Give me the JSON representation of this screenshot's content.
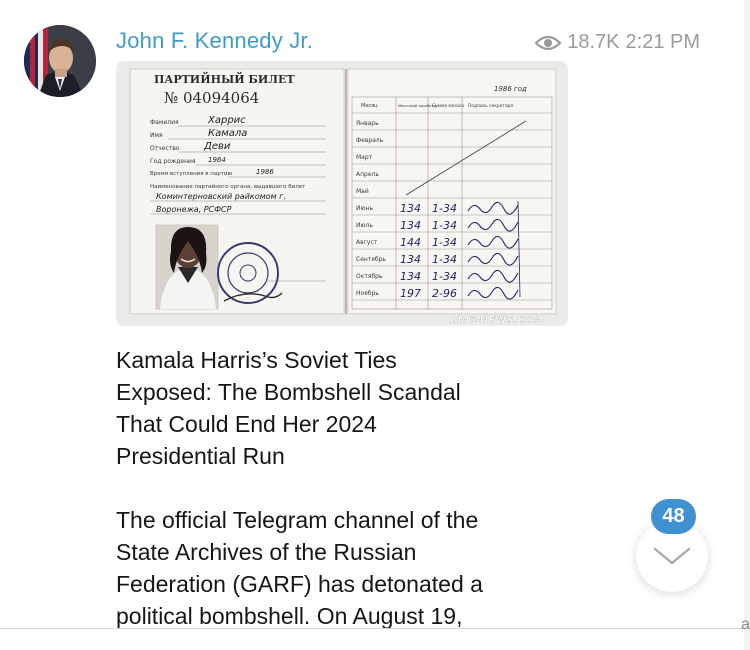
{
  "channel": {
    "name": "John F. Kennedy Jr."
  },
  "post": {
    "views": "18.7K",
    "time": "2:21 PM",
    "image_watermark": "AMG-NEWS.COM",
    "document": {
      "header": "ПАРТИЙНЫЙ БИЛЕТ",
      "number": "№ 04094064",
      "fields": [
        {
          "label": "Фамилия",
          "value": "Харрис"
        },
        {
          "label": "Имя",
          "value": "Камала"
        },
        {
          "label": "Отчество",
          "value": "Деви"
        },
        {
          "label": "Год рождения",
          "value": "1964"
        },
        {
          "label": "Время вступления в партию",
          "value": "1986"
        },
        {
          "label": "Наименование партийного органа, выдавшего билет",
          "value": "Коминтерновский райкомом г."
        },
        {
          "label": "",
          "value": "Воронежа, РСФСР"
        }
      ],
      "table_year": "1986 год",
      "table_headers": [
        "Месяц",
        "Месячный заработок",
        "Сумма взноса",
        "Подпись секретаря"
      ],
      "rows": [
        {
          "month": "Январь",
          "earnings": "",
          "dues": ""
        },
        {
          "month": "Февраль",
          "earnings": "",
          "dues": ""
        },
        {
          "month": "Март",
          "earnings": "",
          "dues": ""
        },
        {
          "month": "Апрель",
          "earnings": "",
          "dues": ""
        },
        {
          "month": "Май",
          "earnings": "",
          "dues": ""
        },
        {
          "month": "Июнь",
          "earnings": "134",
          "dues": "1-34"
        },
        {
          "month": "Июль",
          "earnings": "134",
          "dues": "1-34"
        },
        {
          "month": "Август",
          "earnings": "144",
          "dues": "1-34"
        },
        {
          "month": "Сентябрь",
          "earnings": "134",
          "dues": "1-34"
        },
        {
          "month": "Октябрь",
          "earnings": "134",
          "dues": "1-34"
        },
        {
          "month": "Ноябрь",
          "earnings": "197",
          "dues": "2-96"
        }
      ]
    },
    "title": "Kamala Harris’s Soviet Ties\nExposed: The Bombshell Scandal\nThat Could End Her 2024\nPresidential Run",
    "body": "The official Telegram channel of the\nState Archives of the Russian\nFederation (GARF) has detonated a\npolitical bombshell. On August 19,"
  },
  "unread_badge": "48",
  "edge_glyph": "a",
  "icons": {
    "views": "eye-icon",
    "scroll": "chevron-down-icon"
  },
  "colors": {
    "channel_name": "#3e9dc4",
    "badge": "#3f91d1",
    "meta": "#9a9a9a",
    "text": "#161616"
  }
}
